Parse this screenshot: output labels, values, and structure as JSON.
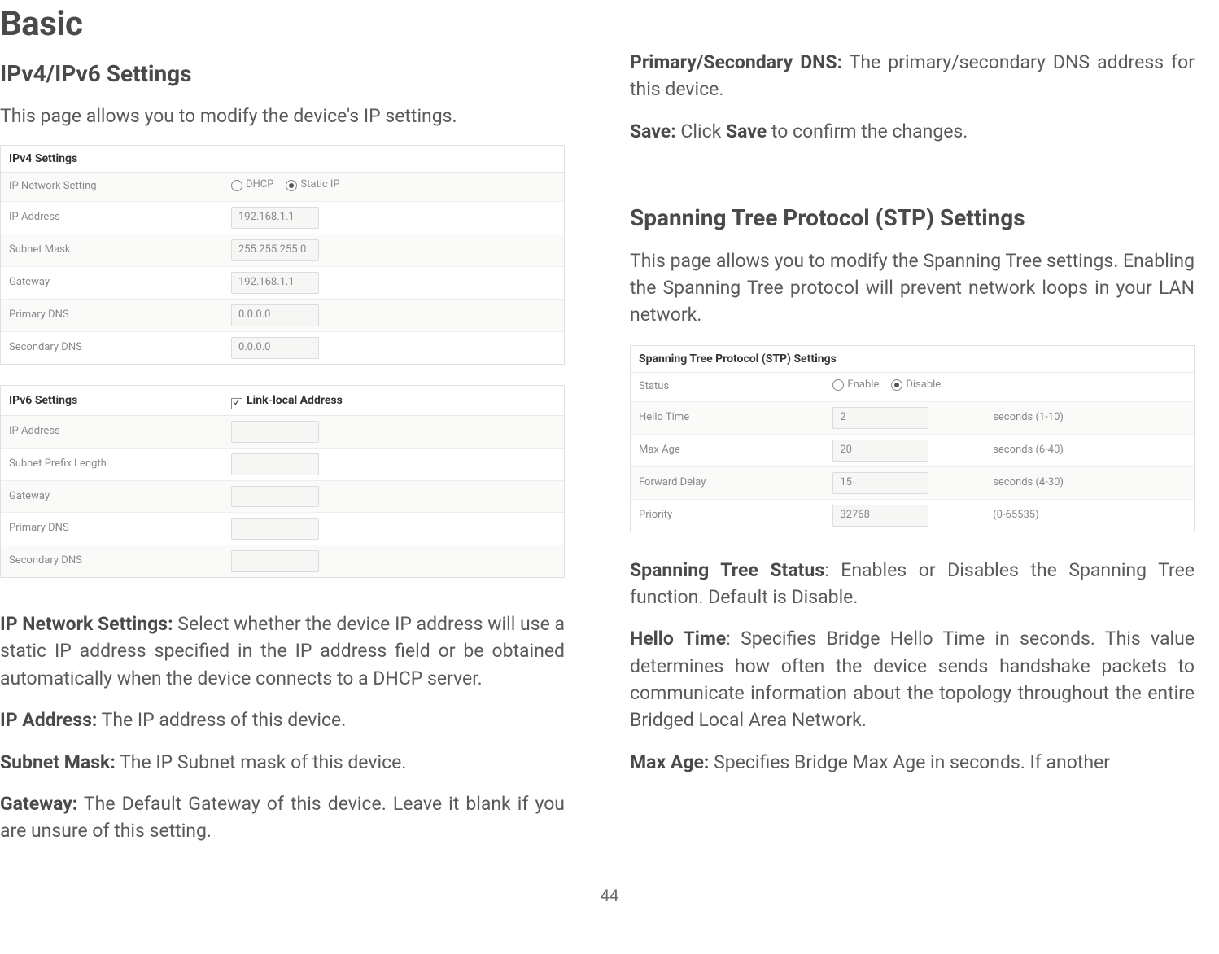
{
  "page_title": "Basic",
  "page_number": "44",
  "left": {
    "heading": "IPv4/IPv6 Settings",
    "intro": "This page allows you to modify the device's IP settings.",
    "ipv4_header": "IPv4 Settings",
    "ipv4_rows": {
      "network_setting": {
        "label": "IP Network Setting",
        "opt1": "DHCP",
        "opt2": "Static IP"
      },
      "ip_address": {
        "label": "IP Address",
        "value": "192.168.1.1"
      },
      "subnet": {
        "label": "Subnet Mask",
        "value": "255.255.255.0"
      },
      "gateway": {
        "label": "Gateway",
        "value": "192.168.1.1"
      },
      "primary_dns": {
        "label": "Primary DNS",
        "value": "0.0.0.0"
      },
      "secondary_dns": {
        "label": "Secondary DNS",
        "value": "0.0.0.0"
      }
    },
    "ipv6_header": "IPv6 Settings",
    "ipv6_check_label": "Link-local Address",
    "ipv6_rows": {
      "ip_address": {
        "label": "IP Address"
      },
      "subnet_prefix": {
        "label": "Subnet Prefix Length"
      },
      "gateway": {
        "label": "Gateway"
      },
      "primary_dns": {
        "label": "Primary DNS"
      },
      "secondary_dns": {
        "label": "Secondary DNS"
      }
    },
    "desc_ip_network_bold": "IP Network Settings:",
    "desc_ip_network": " Select whether the device IP address will use a static IP address specified in the IP address field or be obtained automatically when the device connects to a DHCP server.",
    "desc_ip_address_bold": "IP Address:",
    "desc_ip_address": " The IP address of this device.",
    "desc_subnet_bold": "Subnet Mask:",
    "desc_subnet": " The IP Subnet mask of this device.",
    "desc_gateway_bold": "Gateway:",
    "desc_gateway": " The Default Gateway of this device. Leave it blank if you are unsure of this setting."
  },
  "right": {
    "desc_dns_bold": "Primary/Secondary DNS:",
    "desc_dns": " The primary/secondary DNS address for this device.",
    "desc_save_bold1": "Save:",
    "desc_save_mid": " Click ",
    "desc_save_bold2": "Save",
    "desc_save_end": " to confirm the changes.",
    "stp_heading": "Spanning Tree Protocol (STP) Settings",
    "stp_intro": "This page allows you to modify the Spanning Tree settings. Enabling the Spanning Tree protocol will prevent network loops in your LAN network.",
    "stp_table_header": "Spanning Tree Protocol (STP) Settings",
    "stp_rows": {
      "status": {
        "label": "Status",
        "opt1": "Enable",
        "opt2": "Disable"
      },
      "hello": {
        "label": "Hello Time",
        "value": "2",
        "hint": "seconds (1-10)"
      },
      "max_age": {
        "label": "Max Age",
        "value": "20",
        "hint": "seconds (6-40)"
      },
      "forward": {
        "label": "Forward Delay",
        "value": "15",
        "hint": "seconds (4-30)"
      },
      "priority": {
        "label": "Priority",
        "value": "32768",
        "hint": "(0-65535)"
      }
    },
    "desc_stp_status_bold": "Spanning Tree Status",
    "desc_stp_status": ": Enables or Disables the Spanning Tree function. Default is Disable.",
    "desc_hello_bold": "Hello Time",
    "desc_hello": ": Specifies Bridge Hello Time in seconds. This value determines how often the device sends handshake packets to communicate information about the topology throughout the entire Bridged Local Area Network.",
    "desc_maxage_bold": "Max Age:",
    "desc_maxage": " Specifies Bridge Max Age in seconds. If another"
  }
}
